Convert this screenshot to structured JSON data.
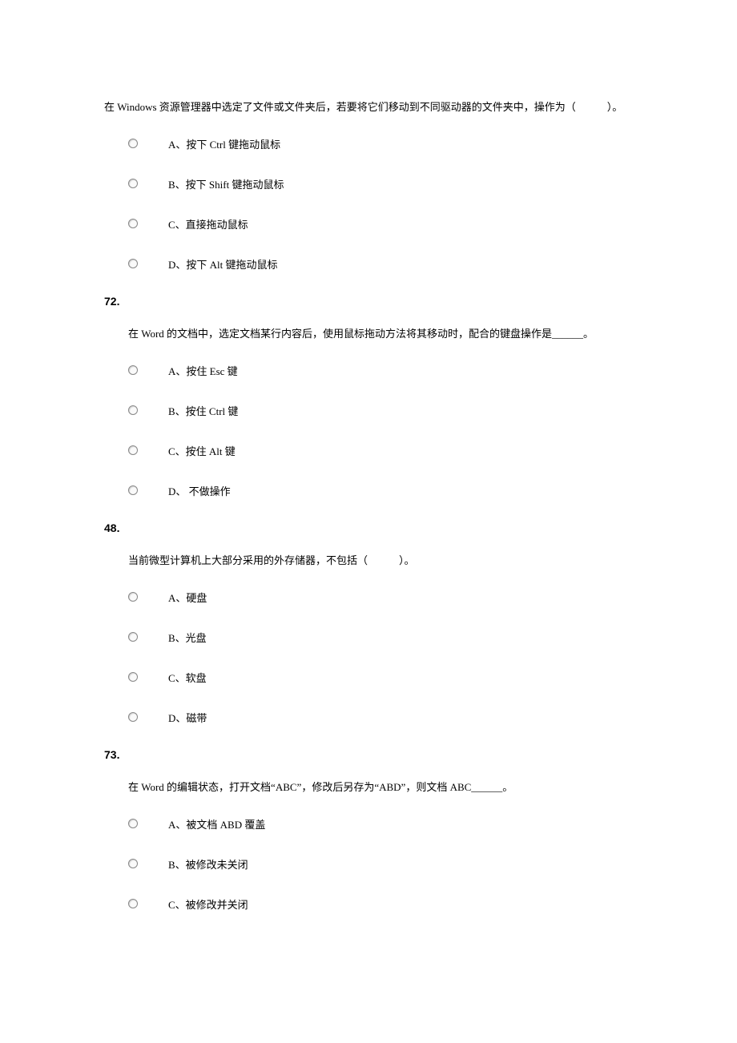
{
  "questions": [
    {
      "number": "",
      "stem": "在 Windows 资源管理器中选定了文件或文件夹后，若要将它们移动到不同驱动器的文件夹中，操作为（　　　）。",
      "options": [
        "A、按下 Ctrl 键拖动鼠标",
        "B、按下 Shift 键拖动鼠标",
        "C、直接拖动鼠标",
        "D、按下 Alt 键拖动鼠标"
      ]
    },
    {
      "number": "72.",
      "stem": "在 Word 的文档中，选定文档某行内容后，使用鼠标拖动方法将其移动时，配合的键盘操作是______。",
      "options": [
        "A、按住 Esc 键",
        "B、按住 Ctrl 键",
        "C、按住 Alt 键",
        "D、 不做操作"
      ]
    },
    {
      "number": "48.",
      "stem": "当前微型计算机上大部分采用的外存储器，不包括（　　　）。",
      "options": [
        "A、硬盘",
        "B、光盘",
        "C、软盘",
        "D、磁带"
      ]
    },
    {
      "number": "73.",
      "stem": "在 Word 的编辑状态，打开文档“ABC”，修改后另存为“ABD”，则文档 ABC______。",
      "options": [
        "A、被文档 ABD 覆盖",
        "B、被修改未关闭",
        "C、被修改并关闭"
      ]
    }
  ]
}
